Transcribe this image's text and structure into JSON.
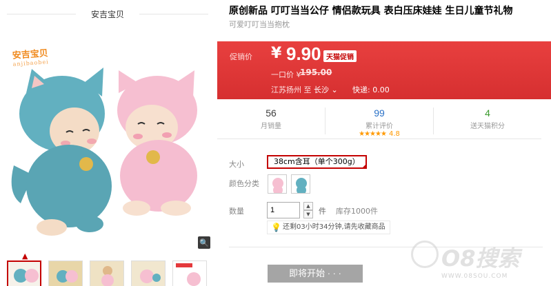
{
  "shop": {
    "name": "安吉宝贝"
  },
  "brand": {
    "logo_text": "安吉宝贝",
    "logo_sub": "anjibaobei"
  },
  "product": {
    "title": "原创新品 叮叮当当公仔 情侣款玩具 表白压床娃娃 生日儿童节礼物",
    "subtitle": "可爱叮叮当当抱枕"
  },
  "price": {
    "label": "促销价",
    "currency": "¥",
    "value": "9.90",
    "promo_tag": "天猫促销",
    "original_label": "一口价 ¥",
    "original_value": "195.00",
    "ship_from": "江苏扬州 至",
    "ship_to": "长沙",
    "ship_fee": "快递: 0.00"
  },
  "stats": [
    {
      "num": "56",
      "label": "月销量",
      "color": "#3c3c3c"
    },
    {
      "num": "99",
      "label": "累计评价",
      "color": "#2a71c7"
    },
    {
      "num": "4",
      "label": "送天猫积分",
      "color": "#3a9a2d"
    }
  ],
  "rating": {
    "stars": "★★★★★",
    "score": "4.8"
  },
  "options": {
    "size_label": "大小",
    "size_value": "38cm含耳（单个300g）",
    "color_label": "颜色分类",
    "qty_label": "数量",
    "qty_value": "1",
    "qty_unit": "件",
    "stock": "库存1000件",
    "tip": "还剩03小时34分钟,请先收藏商品"
  },
  "buy": {
    "label": "即将开始 · · ·"
  },
  "watermark": {
    "text": "O8搜索",
    "sub": "WWW.08SOU.COM"
  },
  "colors": {
    "accent": "#c40000",
    "price_bg": "#e4393c",
    "disabled_btn": "#a5a5a5"
  }
}
